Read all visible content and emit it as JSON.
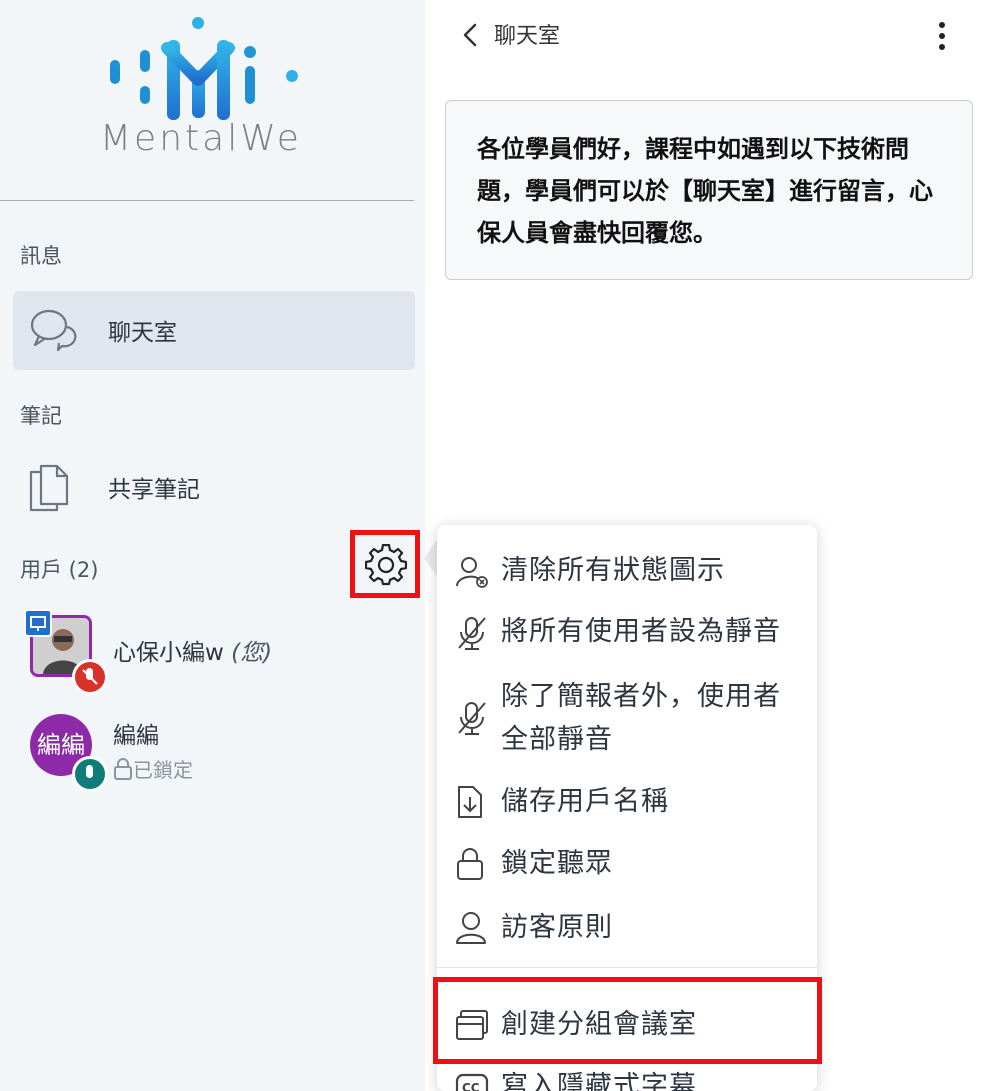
{
  "sidebar": {
    "logo_text": "MentalWe",
    "messages_title": "訊息",
    "chat_label": "聊天室",
    "notes_title": "筆記",
    "shared_notes_label": "共享筆記",
    "users_title": "用戶 (2)",
    "users": [
      {
        "name": "心保小編w",
        "self_tag": "(您)",
        "avatar_initials": ""
      },
      {
        "name": "編編",
        "status": "已鎖定",
        "avatar_initials": "編編"
      }
    ]
  },
  "chat": {
    "title": "聊天室",
    "welcome": "各位學員們好，課程中如遇到以下技術問題，學員們可以於【聊天室】進行留言，心保人員會盡快回覆您。"
  },
  "menu": {
    "items": [
      {
        "label": "清除所有狀態圖示",
        "icon": "clear-status-icon"
      },
      {
        "label": "將所有使用者設為靜音",
        "icon": "mic-off-icon"
      },
      {
        "label": "除了簡報者外，使用者全部靜音",
        "icon": "mic-off-icon"
      },
      {
        "label": "儲存用戶名稱",
        "icon": "download-icon"
      },
      {
        "label": "鎖定聽眾",
        "icon": "lock-icon"
      },
      {
        "label": "訪客原則",
        "icon": "user-icon"
      },
      {
        "label": "創建分組會議室",
        "icon": "breakout-icon"
      },
      {
        "label": "寫入隱藏式字幕",
        "icon": "cc-icon"
      }
    ]
  },
  "colors": {
    "highlight_red": "#ee1111",
    "logo_blue": "#2196d3",
    "avatar_purple": "#8e2aa8",
    "mic_red": "#d9322b",
    "mic_teal": "#0f7d7a"
  }
}
